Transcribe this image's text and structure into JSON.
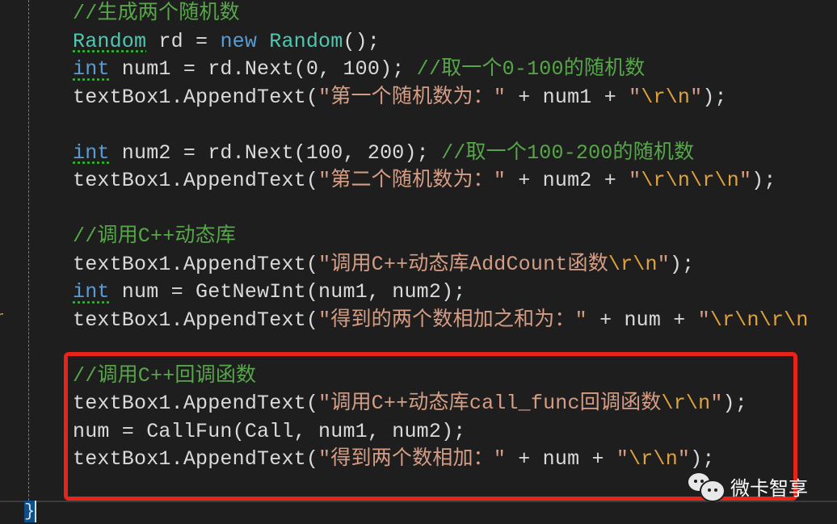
{
  "editor": {
    "lines": [
      [
        {
          "t": "//生成两个随机数",
          "c": "cm"
        }
      ],
      [
        {
          "t": "Random",
          "c": "ty sq"
        },
        {
          "t": " rd = ",
          "c": "id"
        },
        {
          "t": "new",
          "c": "kw"
        },
        {
          "t": " ",
          "c": "id"
        },
        {
          "t": "Random",
          "c": "ty"
        },
        {
          "t": "();",
          "c": "id"
        }
      ],
      [
        {
          "t": "int",
          "c": "kw sq"
        },
        {
          "t": " num1 = rd.Next(0, 100); ",
          "c": "id"
        },
        {
          "t": "//取一个0-100的随机数",
          "c": "cm"
        }
      ],
      [
        {
          "t": "textBox1.AppendText(",
          "c": "id"
        },
        {
          "t": "\"第一个随机数为：\"",
          "c": "st"
        },
        {
          "t": " + num1 + ",
          "c": "id"
        },
        {
          "t": "\"",
          "c": "st"
        },
        {
          "t": "\\r\\n",
          "c": "esc"
        },
        {
          "t": "\"",
          "c": "st"
        },
        {
          "t": ");",
          "c": "id"
        }
      ],
      [],
      [
        {
          "t": "int",
          "c": "kw sq"
        },
        {
          "t": " num2 = rd.Next(100, 200); ",
          "c": "id"
        },
        {
          "t": "//取一个100-200的随机数",
          "c": "cm"
        }
      ],
      [
        {
          "t": "textBox1.AppendText(",
          "c": "id"
        },
        {
          "t": "\"第二个随机数为：\"",
          "c": "st"
        },
        {
          "t": " + num2 + ",
          "c": "id"
        },
        {
          "t": "\"",
          "c": "st"
        },
        {
          "t": "\\r\\n\\r\\n",
          "c": "esc"
        },
        {
          "t": "\"",
          "c": "st"
        },
        {
          "t": ");",
          "c": "id"
        }
      ],
      [],
      [
        {
          "t": "//调用C++动态库",
          "c": "cm"
        }
      ],
      [
        {
          "t": "textBox1.AppendText(",
          "c": "id"
        },
        {
          "t": "\"调用C++动态库AddCount函数",
          "c": "st"
        },
        {
          "t": "\\r\\n",
          "c": "esc"
        },
        {
          "t": "\"",
          "c": "st"
        },
        {
          "t": ");",
          "c": "id"
        }
      ],
      [
        {
          "t": "int",
          "c": "kw sq"
        },
        {
          "t": " num = GetNewInt(num1, num2);",
          "c": "id"
        }
      ],
      [
        {
          "t": "textBox1.AppendText(",
          "c": "id"
        },
        {
          "t": "\"得到的两个数相加之和为：\"",
          "c": "st"
        },
        {
          "t": " + num + ",
          "c": "id"
        },
        {
          "t": "\"",
          "c": "st"
        },
        {
          "t": "\\r\\n\\r\\n",
          "c": "esc"
        }
      ],
      [],
      [
        {
          "t": "//调用C++回调函数",
          "c": "cm"
        }
      ],
      [
        {
          "t": "textBox1.AppendText(",
          "c": "id"
        },
        {
          "t": "\"调用C++动态库call_func回调函数",
          "c": "st"
        },
        {
          "t": "\\r\\n",
          "c": "esc"
        },
        {
          "t": "\"",
          "c": "st"
        },
        {
          "t": ");",
          "c": "id"
        }
      ],
      [
        {
          "t": "num = CallFun(Call, num1, num2);",
          "c": "id"
        }
      ],
      [
        {
          "t": "textBox1.AppendText(",
          "c": "id"
        },
        {
          "t": "\"得到两个数相加：\"",
          "c": "st"
        },
        {
          "t": " + num + ",
          "c": "id"
        },
        {
          "t": "\"",
          "c": "st"
        },
        {
          "t": "\\r\\n",
          "c": "esc"
        },
        {
          "t": "\"",
          "c": "st"
        },
        {
          "t": ");",
          "c": "id"
        }
      ]
    ],
    "closing_brace": "}",
    "gutter_mark": "n"
  },
  "highlight": {
    "color": "#e8231a"
  },
  "watermark": {
    "text": "微卡智享",
    "icon": "wechat-icon"
  }
}
